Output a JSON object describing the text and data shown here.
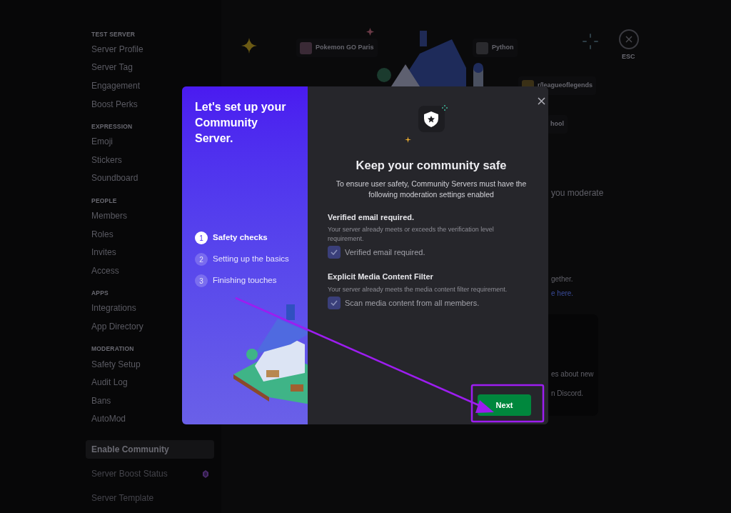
{
  "sidebar": {
    "sections": [
      {
        "heading": "TEST SERVER",
        "items": [
          {
            "label": "Server Profile",
            "selected": false
          },
          {
            "label": "Server Tag",
            "selected": false
          },
          {
            "label": "Engagement",
            "selected": false
          },
          {
            "label": "Boost Perks",
            "selected": false
          }
        ]
      },
      {
        "heading": "EXPRESSION",
        "items": [
          {
            "label": "Emoji",
            "selected": false
          },
          {
            "label": "Stickers",
            "selected": false
          },
          {
            "label": "Soundboard",
            "selected": false
          }
        ]
      },
      {
        "heading": "PEOPLE",
        "items": [
          {
            "label": "Members",
            "selected": false
          },
          {
            "label": "Roles",
            "selected": false
          },
          {
            "label": "Invites",
            "selected": false
          },
          {
            "label": "Access",
            "selected": false
          }
        ]
      },
      {
        "heading": "APPS",
        "items": [
          {
            "label": "Integrations",
            "selected": false
          },
          {
            "label": "App Directory",
            "selected": false
          }
        ]
      },
      {
        "heading": "MODERATION",
        "items": [
          {
            "label": "Safety Setup",
            "selected": false
          },
          {
            "label": "Audit Log",
            "selected": false
          },
          {
            "label": "Bans",
            "selected": false
          },
          {
            "label": "AutoMod",
            "selected": false
          }
        ]
      }
    ],
    "bottom_items": [
      {
        "label": "Enable Community",
        "selected": true,
        "kind": "plain"
      },
      {
        "label": "Server Boost Status",
        "selected": false,
        "kind": "boost"
      },
      {
        "label": "Server Template",
        "selected": false,
        "kind": "plain"
      }
    ]
  },
  "background": {
    "server_chips": [
      "Pokemon GO Paris",
      "Python",
      "r/leagueoflegends",
      "hool"
    ],
    "text_fragments": [
      "you moderate",
      "gether.",
      "e here.",
      "es about new",
      "n Discord."
    ],
    "close_label": "ESC"
  },
  "modal": {
    "title": "Let's set up your Community Server.",
    "steps": [
      {
        "number": "1",
        "label": "Safety checks",
        "selected": true
      },
      {
        "number": "2",
        "label": "Setting up the basics",
        "selected": false
      },
      {
        "number": "3",
        "label": "Finishing touches",
        "selected": false
      }
    ],
    "heading": "Keep your community safe",
    "description": "To ensure user safety, Community Servers must have the following moderation settings enabled",
    "settings": [
      {
        "title": "Verified email required.",
        "note": "Your server already meets or exceeds the verification level requirement.",
        "checkbox_label": "Verified email required.",
        "checked": true
      },
      {
        "title": "Explicit Media Content Filter",
        "note": "Your server already meets the media content filter requirement.",
        "checkbox_label": "Scan media content from all members.",
        "checked": true
      }
    ],
    "next_button": "Next"
  }
}
